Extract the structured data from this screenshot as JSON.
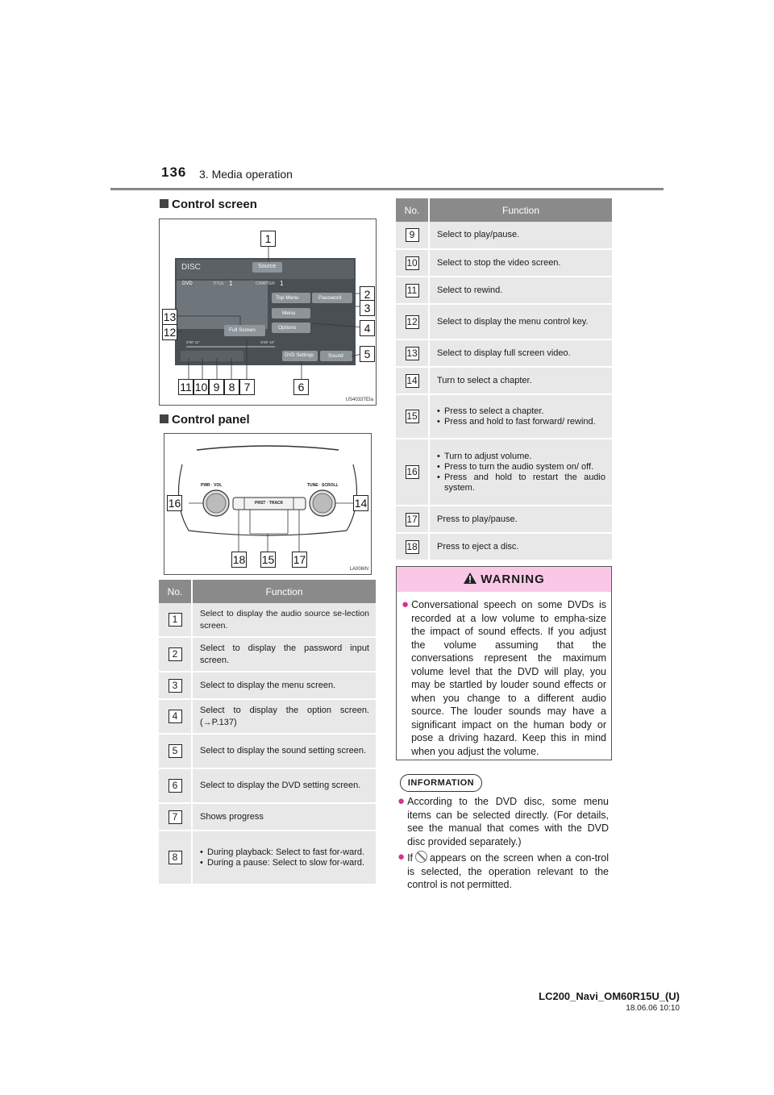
{
  "header": {
    "page_number": "136",
    "chapter": "3. Media operation"
  },
  "sections": {
    "control_screen": "Control screen",
    "control_panel": "Control panel"
  },
  "figure1": {
    "code": "US4033TEIa",
    "screen": {
      "disc": "DISC",
      "source": "Source",
      "dvd": "DVD",
      "title_label": "TITLE",
      "title_value": "1",
      "chapter_label": "CHAPTER",
      "chapter_value": "1",
      "top_menu": "Top Menu",
      "password": "Password",
      "menu": "Menu",
      "options": "Options",
      "full_screen": "Full Screen",
      "time_elapsed": "0’00’ 11”",
      "time_remaining": "-0’00’ 10”",
      "dvd_settings": "DVD Settings",
      "sound": "Sound"
    }
  },
  "figure2": {
    "code": "LA006IN",
    "pwr_vol": "PWR · VOL",
    "tune_scroll": "TUNE · SCROLL",
    "prst_track": "PRST · TRACK"
  },
  "table_left": {
    "headers": {
      "no": "No.",
      "function": "Function"
    },
    "rows": [
      {
        "no": "1",
        "function": "Select to display the audio source se-lection screen."
      },
      {
        "no": "2",
        "function": "Select to display the password input screen."
      },
      {
        "no": "3",
        "function": "Select to display the menu screen."
      },
      {
        "no": "4",
        "function": "Select to display the option screen. (→P.137)"
      },
      {
        "no": "5",
        "function": "Select to display the sound setting screen."
      },
      {
        "no": "6",
        "function": "Select to display the DVD setting screen."
      },
      {
        "no": "7",
        "function": "Shows progress"
      },
      {
        "no": "8",
        "bullets": [
          "During playback: Select to fast for-ward.",
          "During a pause: Select to slow for-ward."
        ]
      }
    ]
  },
  "table_right": {
    "headers": {
      "no": "No.",
      "function": "Function"
    },
    "rows": [
      {
        "no": "9",
        "function": "Select to play/pause."
      },
      {
        "no": "10",
        "function": "Select to stop the video screen."
      },
      {
        "no": "11",
        "function": "Select to rewind."
      },
      {
        "no": "12",
        "function": "Select to display the menu control key."
      },
      {
        "no": "13",
        "function": "Select to display full screen video."
      },
      {
        "no": "14",
        "function": "Turn to select a chapter."
      },
      {
        "no": "15",
        "bullets": [
          "Press to select a chapter.",
          "Press and hold to fast forward/ rewind."
        ]
      },
      {
        "no": "16",
        "bullets": [
          "Turn to adjust volume.",
          "Press to turn the audio system on/ off.",
          "Press and hold to restart the audio system."
        ]
      },
      {
        "no": "17",
        "function": "Press to play/pause."
      },
      {
        "no": "18",
        "function": "Press to eject a disc."
      }
    ]
  },
  "warning": {
    "title": "WARNING",
    "text": "Conversational speech on some DVDs is recorded at a low volume to empha-size the impact of sound effects. If you adjust the volume assuming that the conversations represent the maximum volume level that the DVD will play, you may be startled by louder sound effects or when you change to a different audio source. The louder sounds may have a significant impact on the human body or pose a driving hazard. Keep this in mind when you adjust the volume."
  },
  "information": {
    "title": "INFORMATION",
    "item1": "According to the DVD disc, some menu items can be selected directly. (For details, see the manual that comes with the DVD disc provided separately.)",
    "item2_before": "If",
    "item2_after": "appears on the screen when a con-trol is selected, the operation relevant to the control is not permitted."
  },
  "footer": {
    "doc": "LC200_Navi_OM60R15U_(U)",
    "date": "18.06.06     10:10"
  },
  "colors": {
    "warning_header": "#f9c8e6",
    "bullet_accent": "#d6338c",
    "table_header": "#8a8a8a",
    "table_cell": "#e8e8e8"
  }
}
